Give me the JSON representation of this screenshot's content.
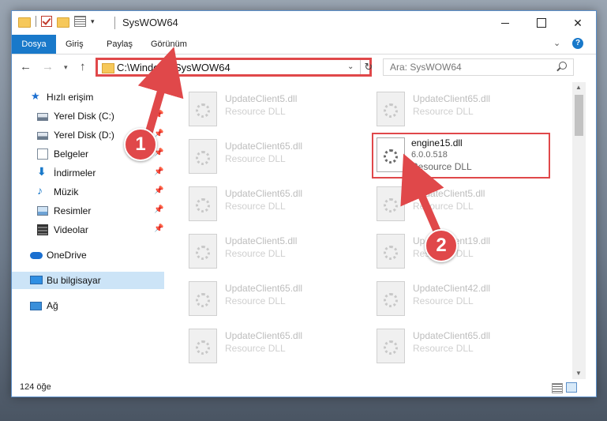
{
  "window": {
    "title": "SysWOW64",
    "controls": {
      "minimize": "—",
      "maximize": "□",
      "close": "✕"
    }
  },
  "ribbon": {
    "tabs": [
      "Dosya",
      "Giriş",
      "Paylaş",
      "Görünüm"
    ]
  },
  "address": {
    "path": "C:\\Windows\\SysWOW64",
    "search_placeholder": "Ara: SysWOW64"
  },
  "navigation": {
    "items": [
      {
        "label": "Hızlı erişim",
        "icon": "star-icon",
        "pinned": false
      },
      {
        "label": "Yerel Disk (C:)",
        "icon": "disk-icon",
        "pinned": true
      },
      {
        "label": "Yerel Disk (D:)",
        "icon": "disk-icon",
        "pinned": true
      },
      {
        "label": "Belgeler",
        "icon": "documents-icon",
        "pinned": true
      },
      {
        "label": "İndirmeler",
        "icon": "download-icon",
        "pinned": true
      },
      {
        "label": "Müzik",
        "icon": "music-icon",
        "pinned": true
      },
      {
        "label": "Resimler",
        "icon": "pictures-icon",
        "pinned": true
      },
      {
        "label": "Videolar",
        "icon": "videos-icon",
        "pinned": true
      },
      {
        "label": "OneDrive",
        "icon": "cloud-icon",
        "pinned": false
      },
      {
        "label": "Bu bilgisayar",
        "icon": "computer-icon",
        "pinned": false,
        "selected": true
      },
      {
        "label": "Ağ",
        "icon": "network-icon",
        "pinned": false
      }
    ]
  },
  "files": {
    "col1": [
      {
        "name": "UpdateClient5.dll",
        "type": "Resource DLL"
      },
      {
        "name": "UpdateClient65.dll",
        "type": "Resource DLL"
      },
      {
        "name": "UpdateClient65.dll",
        "type": "Resource DLL"
      },
      {
        "name": "UpdateClient5.dll",
        "type": "Resource DLL"
      },
      {
        "name": "UpdateClient65.dll",
        "type": "Resource DLL"
      },
      {
        "name": "UpdateClient65.dll",
        "type": "Resource DLL"
      }
    ],
    "col2": [
      {
        "name": "UpdateClient65.dll",
        "type": "Resource DLL"
      },
      {
        "name": "UpdateClient5.dll",
        "type": "Resource DLL"
      },
      {
        "name": "UpdateClient19.dll",
        "type": "Resource DLL"
      },
      {
        "name": "UpdateClient42.dll",
        "type": "Resource DLL"
      },
      {
        "name": "UpdateClient65.dll",
        "type": "Resource DLL"
      }
    ],
    "highlighted": {
      "name": "engine15.dll",
      "version": "6.0.0.518",
      "type": "Resource DLL"
    }
  },
  "status": {
    "count": "124 öğe"
  },
  "annotations": {
    "marker1": "1",
    "marker2": "2",
    "color": "#e0484a"
  }
}
